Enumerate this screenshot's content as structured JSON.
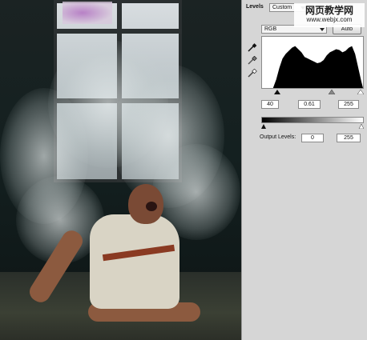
{
  "levels_panel": {
    "title": "Levels",
    "preset": "Custom",
    "channel": "RGB",
    "auto_label": "Auto",
    "input_black": "40",
    "input_gamma": "0.61",
    "input_white": "255",
    "output_label": "Output Levels:",
    "output_black": "0",
    "output_white": "255",
    "tools": [
      "eyedropper-black-icon",
      "eyedropper-gray-icon",
      "eyedropper-white-icon"
    ]
  },
  "watermark": {
    "line1": "网页教学网",
    "line2": "www.webjx.com"
  },
  "colors": {
    "panel_bg": "#d6d6d6",
    "histogram_fill": "#000000"
  }
}
